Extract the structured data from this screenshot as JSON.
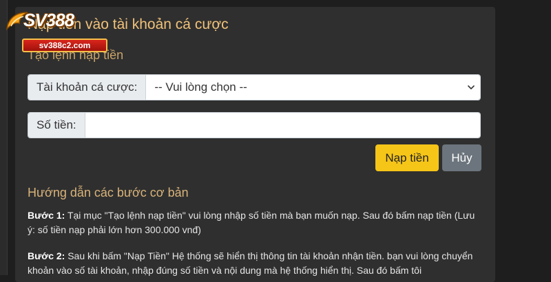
{
  "brand": {
    "logo_text": "SV388",
    "logo_domain": "sv388c2.com"
  },
  "panel": {
    "title": "Nạp tiền vào tài khoản cá cược",
    "section_title": "Tạo lệnh nạp tiền"
  },
  "form": {
    "account_label": "Tài khoản cá cược:",
    "account_selected": "-- Vui lòng chọn --",
    "amount_label": "Số tiền:",
    "amount_value": ""
  },
  "buttons": {
    "deposit_label": "Nạp tiền",
    "cancel_label": "Hủy"
  },
  "guide": {
    "title": "Hướng dẫn các bước cơ bản",
    "step1_label": "Bước 1:",
    "step1_text": " Tại mục \"Tạo lệnh nạp tiền\" vui lòng nhập số tiền mà bạn muốn nạp. Sau đó bấm nạp tiền (Lưu ý: số tiền nạp phải lớn hơn 300.000 vnđ)",
    "step2_label": "Bước 2:",
    "step2_text": " Sau khi bấm \"Nạp Tiền\" Hệ thống sẽ hiển thị thông tin tài khoản nhận tiền. bạn vui lòng chuyển khoản vào số tài khoản, nhập đúng số tiền và nội dung mà hệ thống hiển thị. Sau đó bấm tôi"
  },
  "colors": {
    "accent_gold": "#f5c518",
    "title_gold": "#f0c27a",
    "panel_bg": "#2f2f2f",
    "cancel_gray": "#6c757d"
  },
  "icons": {
    "select_arrow": "chevron-down-icon"
  }
}
